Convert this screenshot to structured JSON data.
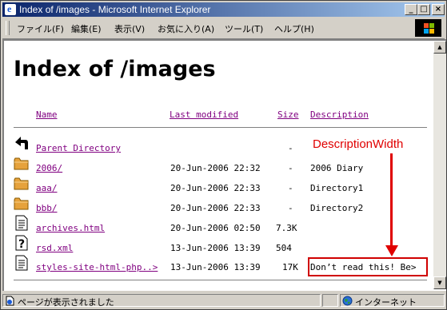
{
  "window": {
    "title": "Index of /images - Microsoft Internet Explorer"
  },
  "titlebar_buttons": {
    "minimize": "_",
    "maximize": "□",
    "close": "×"
  },
  "menu": [
    "ファイル(F)",
    "編集(E)",
    "表示(V)",
    "お気に入り(A)",
    "ツール(T)",
    "ヘルプ(H)"
  ],
  "page": {
    "heading": "Index of /images",
    "columns": {
      "name": "Name",
      "last_modified": "Last modified",
      "size": "Size",
      "description": "Description"
    },
    "rows": [
      {
        "icon": "back-arrow-icon",
        "name": "Parent Directory",
        "modified": "",
        "size": "-",
        "description": ""
      },
      {
        "icon": "folder-icon",
        "name": "2006/",
        "modified": "20-Jun-2006 22:32",
        "size": "-",
        "description": "2006 Diary"
      },
      {
        "icon": "folder-icon",
        "name": "aaa/",
        "modified": "20-Jun-2006 22:33",
        "size": "-",
        "description": "Directory1"
      },
      {
        "icon": "folder-icon",
        "name": "bbb/",
        "modified": "20-Jun-2006 22:33",
        "size": "-",
        "description": "Directory2"
      },
      {
        "icon": "text-file-icon",
        "name": "archives.html",
        "modified": "20-Jun-2006 02:50",
        "size": "7.3K",
        "description": ""
      },
      {
        "icon": "unknown-file-icon",
        "name": "rsd.xml",
        "modified": "13-Jun-2006 13:39",
        "size": "504",
        "description": ""
      },
      {
        "icon": "text-file-icon",
        "name": "styles-site-html-php..>",
        "modified": "13-Jun-2006 13:39",
        "size": "17K",
        "description": "Don’t read this! Be>"
      }
    ]
  },
  "annotation": {
    "label": "DescriptionWidth",
    "color": "#e00000"
  },
  "status": {
    "text": "ページが表示されました",
    "zone": "インターネット"
  },
  "colors": {
    "visited_link": "#800080",
    "titlebar_start": "#0a246a",
    "titlebar_end": "#a6caf0",
    "chrome": "#d4d0c8"
  }
}
